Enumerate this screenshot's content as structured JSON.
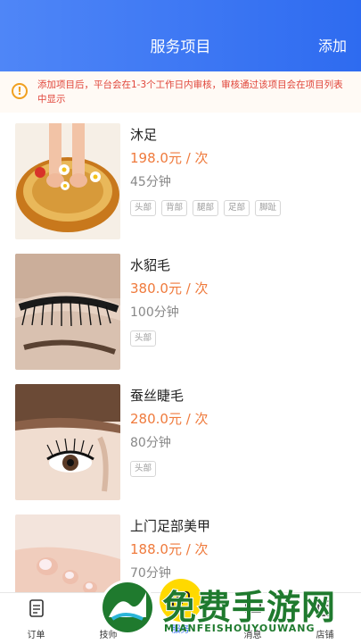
{
  "header": {
    "title": "服务项目",
    "add_label": "添加"
  },
  "notice": {
    "text": "添加项目后，平台会在1-3个工作日内审核，审核通过该项目会在项目列表中显示"
  },
  "services": [
    {
      "name": "沐足",
      "price": "198.0元 / 次",
      "duration": "45分钟",
      "tags": [
        "头部",
        "背部",
        "腿部",
        "足部",
        "脚趾"
      ],
      "image": "foot-bath"
    },
    {
      "name": "水貂毛",
      "price": "380.0元 / 次",
      "duration": "100分钟",
      "tags": [
        "头部"
      ],
      "image": "eyelash-closed"
    },
    {
      "name": "蚕丝睫毛",
      "price": "280.0元 / 次",
      "duration": "80分钟",
      "tags": [
        "头部"
      ],
      "image": "eyelash-open"
    },
    {
      "name": "上门足部美甲",
      "price": "188.0元 / 次",
      "duration": "70分钟",
      "tags": [],
      "image": "toenail"
    }
  ],
  "tabbar": [
    {
      "label": "订单",
      "icon": "order-icon"
    },
    {
      "label": "技师",
      "icon": "technician-icon"
    },
    {
      "label": "服务",
      "icon": "service-icon",
      "active": true
    },
    {
      "label": "消息",
      "icon": "message-icon"
    },
    {
      "label": "店铺",
      "icon": "store-icon"
    }
  ],
  "watermark": {
    "text": "免费手游网",
    "sub": "MIANFEISHOUYOUWANG"
  },
  "colors": {
    "header": "#2e6bf0",
    "price": "#ef7a3c",
    "notice_text": "#e0453a",
    "active_tab": "#2e6bf0"
  }
}
